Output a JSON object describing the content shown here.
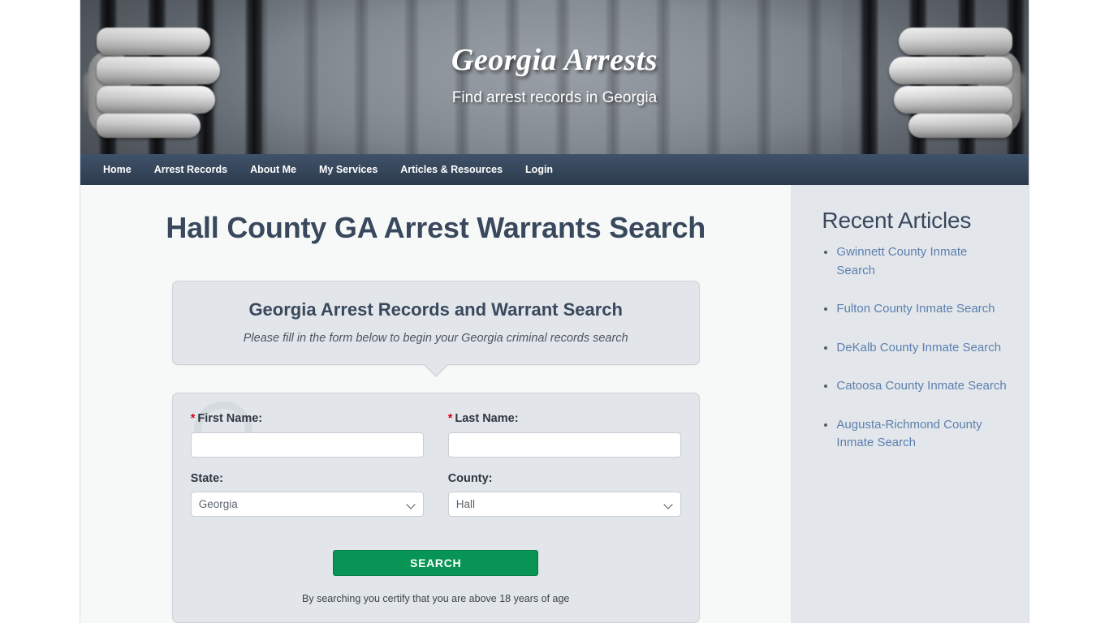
{
  "banner": {
    "site_title": "Georgia Arrests",
    "tagline": "Find arrest records in Georgia"
  },
  "nav": {
    "items": [
      {
        "label": "Home"
      },
      {
        "label": "Arrest Records"
      },
      {
        "label": "About Me"
      },
      {
        "label": "My Services"
      },
      {
        "label": "Articles & Resources"
      },
      {
        "label": "Login"
      }
    ]
  },
  "main": {
    "page_title": "Hall County GA Arrest Warrants Search",
    "callout": {
      "title": "Georgia Arrest Records and Warrant Search",
      "subtitle": "Please fill in the form below to begin your Georgia criminal records search"
    },
    "form": {
      "required_marker": "*",
      "first_name_label": "First Name:",
      "first_name_value": "",
      "first_name_placeholder": "",
      "last_name_label": "Last Name:",
      "last_name_value": "",
      "last_name_placeholder": "",
      "state_label": "State:",
      "state_value": "Georgia",
      "county_label": "County:",
      "county_value": "Hall",
      "submit_label": "SEARCH",
      "disclaimer": "By searching you certify that you are above 18 years of age"
    }
  },
  "sidebar": {
    "title": "Recent Articles",
    "articles": [
      {
        "label": "Gwinnett County Inmate Search"
      },
      {
        "label": "Fulton County Inmate Search"
      },
      {
        "label": "DeKalb County Inmate Search"
      },
      {
        "label": "Catoosa County Inmate Search"
      },
      {
        "label": "Augusta-Richmond County Inmate Search"
      }
    ]
  },
  "colors": {
    "nav_bg": "#36465a",
    "heading": "#39485c",
    "link": "#5c7fad",
    "button": "#089455",
    "required": "#d0021b",
    "panel_bg": "#e2e6eb",
    "sidebar_bg": "#e3e7ec",
    "page_bg": "#f7f9f9"
  }
}
